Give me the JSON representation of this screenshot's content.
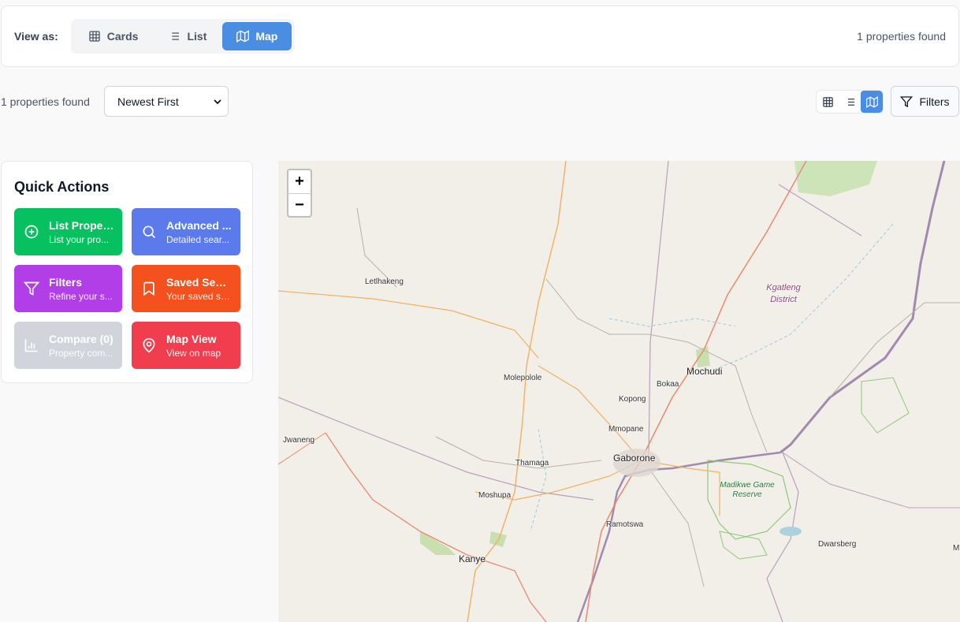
{
  "view_bar": {
    "label": "View as:",
    "modes": [
      {
        "label": "Cards",
        "icon": "grid-icon",
        "active": false
      },
      {
        "label": "List",
        "icon": "list-icon",
        "active": false
      },
      {
        "label": "Map",
        "icon": "map-icon",
        "active": true
      }
    ],
    "count": "1 properties found"
  },
  "toolbar": {
    "count": "1 properties found",
    "sort_selected": "Newest First",
    "view_icons": [
      "grid-icon",
      "list-icon",
      "map-icon"
    ],
    "filters_label": "Filters"
  },
  "quick_actions": {
    "title": "Quick Actions",
    "items": [
      {
        "title": "List Property",
        "subtitle": "List your pro...",
        "color": "#07c160",
        "icon": "plus-circle-icon"
      },
      {
        "title": "Advanced ...",
        "subtitle": "Detailed sear...",
        "color": "#5b7bec",
        "icon": "search-icon"
      },
      {
        "title": "Filters",
        "subtitle": "Refine your s...",
        "color": "#b13ee6",
        "icon": "filter-icon"
      },
      {
        "title": "Saved Sear...",
        "subtitle": "Your saved se...",
        "color": "#f4511e",
        "icon": "bookmark-icon"
      },
      {
        "title": "Compare (0)",
        "subtitle": "Property com...",
        "color": "#d1d5db",
        "icon": "bar-chart-icon"
      },
      {
        "title": "Map View",
        "subtitle": "View on map",
        "color": "#f03e4f",
        "icon": "map-pin-icon"
      }
    ]
  },
  "map": {
    "zoom_in": "+",
    "zoom_out": "−",
    "places": {
      "letlhakeng": "Letlhakeng",
      "kgatleng": "Kgatleng District",
      "mochudi": "Mochudi",
      "bokaa": "Bokaa",
      "molepolole": "Molepolole",
      "kopong": "Kopong",
      "mmopane": "Mmopane",
      "jwaneng": "Jwaneng",
      "gaborone": "Gaborone",
      "thamaga": "Thamaga",
      "madikwe": "Madikwe Game Reserve",
      "moshupa": "Moshupa",
      "ramotswa": "Ramotswa",
      "dwarsberg": "Dwarsberg",
      "kanye": "Kanye",
      "edge_m": "M"
    }
  }
}
